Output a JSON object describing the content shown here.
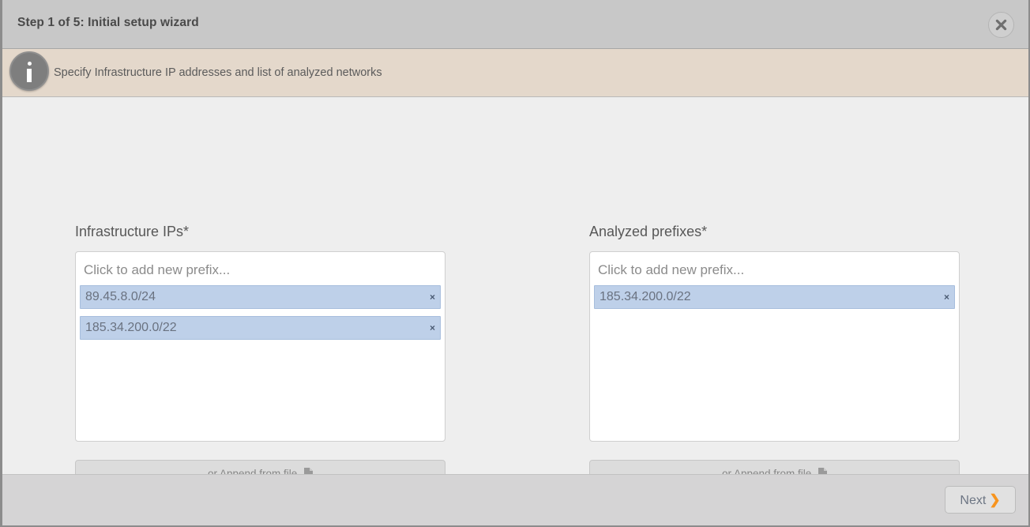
{
  "dialog": {
    "title": "Step 1 of 5: Initial setup wizard",
    "close_icon": "close-icon",
    "info": {
      "icon": "info-icon",
      "message": "Specify Infrastructure IP addresses and list of analyzed networks"
    }
  },
  "panels": [
    {
      "label": "Infrastructure IPs*",
      "placeholder": "Click to add new prefix...",
      "chips": [
        {
          "value": "89.45.8.0/24",
          "remove": "×"
        },
        {
          "value": "185.34.200.0/22",
          "remove": "×"
        }
      ],
      "append_label": "or Append from file",
      "append_icon": "file-icon"
    },
    {
      "label": "Analyzed prefixes*",
      "placeholder": "Click to add new prefix...",
      "chips": [
        {
          "value": "185.34.200.0/22",
          "remove": "×"
        }
      ],
      "append_label": "or Append from file",
      "append_icon": "file-icon"
    }
  ],
  "footer": {
    "next_label": "Next",
    "next_chevron": "❯"
  },
  "colors": {
    "header_bg": "#c8c8c8",
    "info_bg": "#e4d8cb",
    "body_bg": "#eeeeee",
    "footer_bg": "#d5d4d5",
    "chip_bg": "#bed0e9",
    "accent": "#f7941e"
  }
}
